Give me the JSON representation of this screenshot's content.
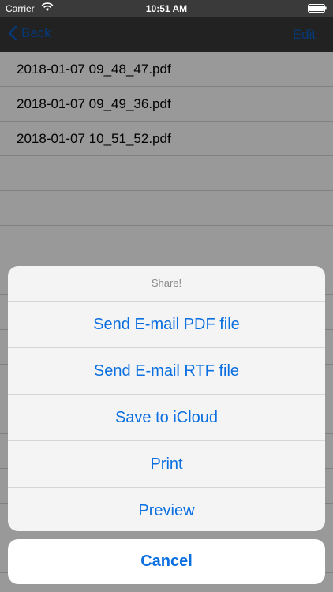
{
  "status_bar": {
    "carrier": "Carrier",
    "time": "10:51 AM"
  },
  "nav": {
    "back_label": "Back",
    "edit_label": "Edit"
  },
  "files": [
    "2018-01-07 09_48_47.pdf",
    "2018-01-07 09_49_36.pdf",
    "2018-01-07 10_51_52.pdf"
  ],
  "action_sheet": {
    "title": "Share!",
    "actions": [
      "Send E-mail PDF file",
      "Send E-mail RTF file",
      "Save to iCloud",
      "Print",
      "Preview"
    ],
    "cancel_label": "Cancel"
  },
  "colors": {
    "accent": "#0a6fe0",
    "bar": "#3a3a3a"
  },
  "icons": {
    "back": "chevron-left-icon",
    "wifi": "wifi-icon",
    "battery": "battery-icon"
  }
}
